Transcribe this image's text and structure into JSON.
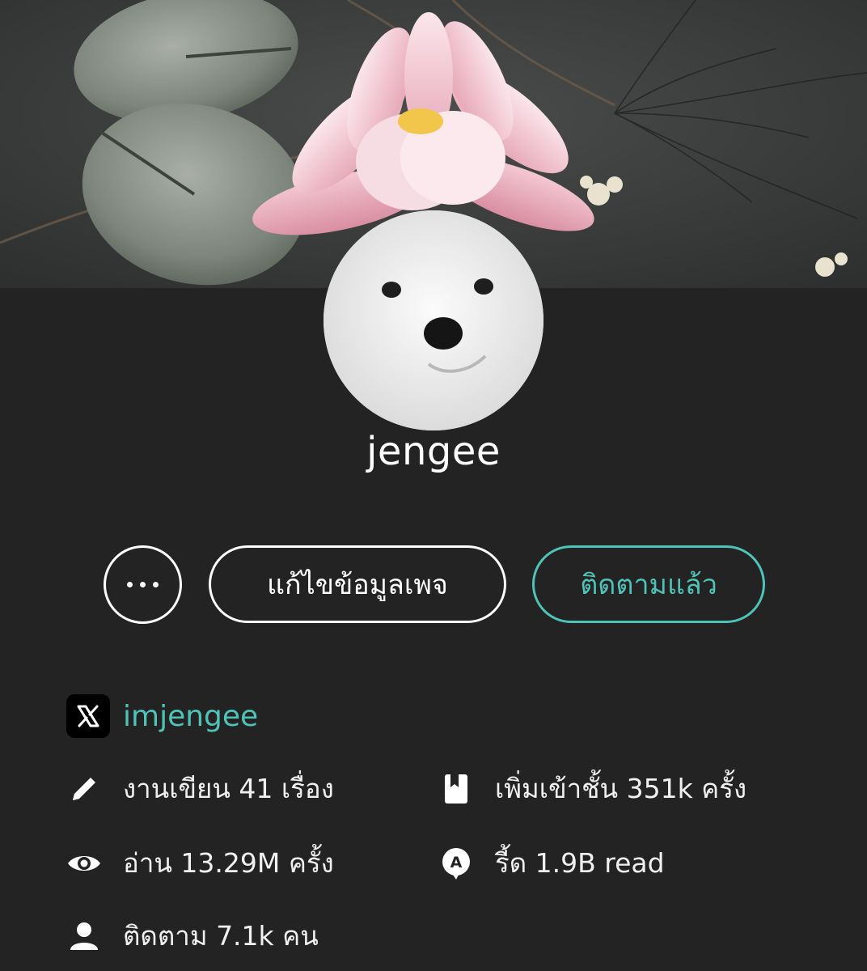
{
  "profile": {
    "username": "jengee",
    "avatar_description": "white fluffy puppy",
    "cover_description": "pink water lily on dark pond with lily pads"
  },
  "actions": {
    "more_icon": "more-horizontal-icon",
    "edit_label": "แก้ไขข้อมูลเพจ",
    "follow_label": "ติดตามแล้ว"
  },
  "social": {
    "platform_icon": "x-logo-icon",
    "handle": "imjengee"
  },
  "stats": {
    "works": {
      "icon": "pencil-icon",
      "text": "งานเขียน 41 เรื่อง"
    },
    "shelf": {
      "icon": "bookmark-book-icon",
      "text": "เพิ่มเข้าชั้น 351k ครั้ง"
    },
    "reads": {
      "icon": "eye-icon",
      "text": "อ่าน 13.29M ครั้ง"
    },
    "rid": {
      "icon": "read-badge-icon",
      "text": "รี้ด 1.9B read"
    },
    "followers": {
      "icon": "person-icon",
      "text": "ติดตาม 7.1k คน"
    }
  },
  "colors": {
    "background": "#232323",
    "accent": "#4fc3b8",
    "text": "#f2f2f2",
    "button_border": "#ffffff"
  }
}
